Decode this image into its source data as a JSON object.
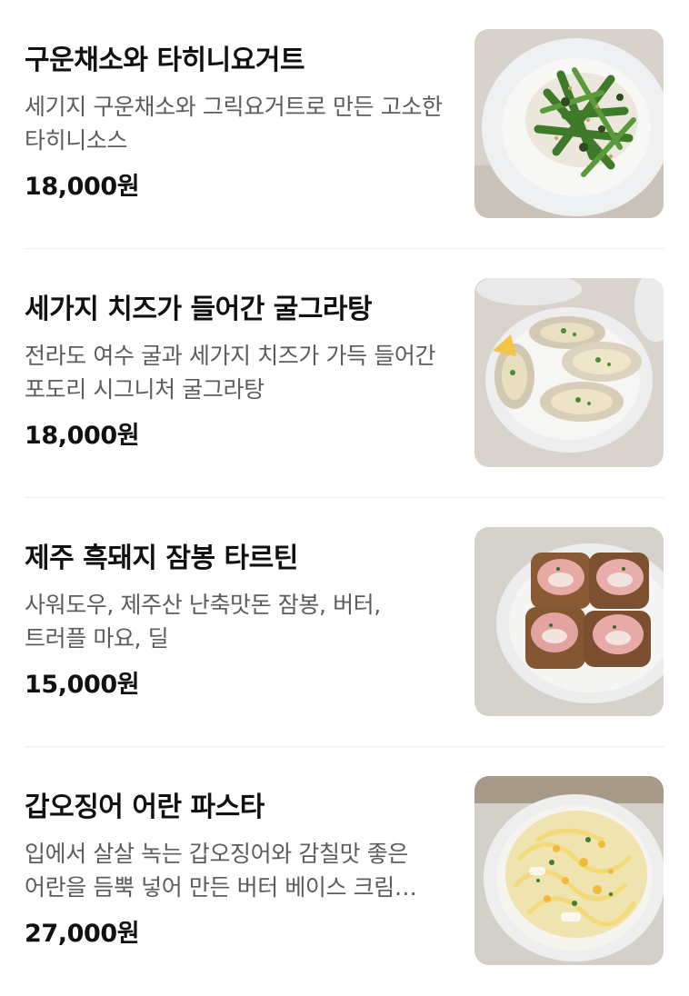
{
  "menu": {
    "items": [
      {
        "name": "구운채소와 타히니요거트",
        "description": "세기지 구운채소와 그릭요거트로 만든 고소한 타히니소스",
        "price": "18,000원",
        "photo_icon": "grilled-vegetables-dish"
      },
      {
        "name": "세가지 치즈가 들어간 굴그라탕",
        "description": "전라도 여수 굴과 세가지 치즈가 가득 들어간 포도리 시그니처 굴그라탕",
        "price": "18,000원",
        "photo_icon": "oyster-gratin-dish"
      },
      {
        "name": "제주 흑돼지 잠봉 타르틴",
        "description": "사워도우, 제주산 난축맛돈 잠봉, 버터, 트러플 마요, 딜",
        "price": "15,000원",
        "photo_icon": "jambon-tartine-dish"
      },
      {
        "name": "갑오징어 어란 파스타",
        "description": "입에서 살살 녹는 갑오징어와 감칠맛 좋은 어란을 듬뿍 넣어 만든 버터 베이스 크림 파스타",
        "price": "27,000원",
        "photo_icon": "squid-bottarga-pasta-dish"
      }
    ]
  }
}
